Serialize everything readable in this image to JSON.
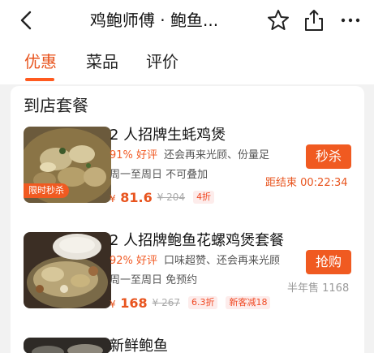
{
  "header": {
    "title": "鸡鲍师傅 · 鲍鱼...",
    "back_icon": "chevron-left-icon",
    "icons": [
      "star-icon",
      "share-icon",
      "more-icon"
    ]
  },
  "tabs": [
    {
      "label": "优惠",
      "active": true
    },
    {
      "label": "菜品",
      "active": false
    },
    {
      "label": "评价",
      "active": false
    }
  ],
  "section": {
    "title": "到店套餐"
  },
  "deals": [
    {
      "name": "2 人招牌生蚝鸡煲",
      "rating": "91% 好评",
      "highlights": "还会再来光顾、份量足",
      "availability": "周一至周日   不可叠加",
      "price_currency": "¥",
      "price": "81.6",
      "original_price": "¥ 204",
      "discount": "4折",
      "button": "秒杀",
      "timer": "距结束 00:22:34",
      "badge": "限时秒杀"
    },
    {
      "name": "2 人招牌鲍鱼花螺鸡煲套餐",
      "rating": "92% 好评",
      "highlights": "口味超赞、还会再来光顾",
      "availability": "周一至周日   免预约",
      "price_currency": "¥",
      "price": "168",
      "original_price": "¥ 267",
      "discount": "6.3折",
      "promo": "新客减18",
      "button": "抢购",
      "sold": "半年售 1168"
    },
    {
      "name": "新鲜鲍鱼"
    }
  ],
  "colors": {
    "accent": "#f05a21",
    "accent_text": "#e8541e",
    "background": "#f2f2f2"
  }
}
